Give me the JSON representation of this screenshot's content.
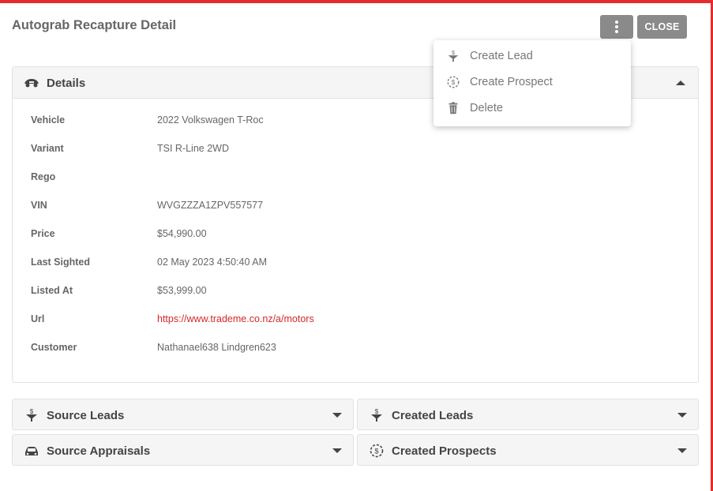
{
  "modal": {
    "title": "Autograb Recapture Detail",
    "close_label": "CLOSE"
  },
  "colors": {
    "accent": "#e52c2c",
    "link": "#d22a2a",
    "button_bg": "#8a8a8a"
  },
  "menu": {
    "items": [
      {
        "label": "Create Lead",
        "icon": "funnel-dollar-icon"
      },
      {
        "label": "Create Prospect",
        "icon": "dollar-target-icon"
      },
      {
        "label": "Delete",
        "icon": "trash-icon"
      }
    ]
  },
  "details": {
    "header": "Details",
    "icon": "car-eye-icon",
    "rows": [
      {
        "label": "Vehicle",
        "value": "2022 Volkswagen T-Roc"
      },
      {
        "label": "Variant",
        "value": "TSI R-Line 2WD"
      },
      {
        "label": "Rego",
        "value": ""
      },
      {
        "label": "VIN",
        "value": "WVGZZZA1ZPV557577"
      },
      {
        "label": "Price",
        "value": "$54,990.00"
      },
      {
        "label": "Last Sighted",
        "value": "02 May 2023 4:50:40 AM"
      },
      {
        "label": "Listed At",
        "value": "$53,999.00"
      },
      {
        "label": "Url",
        "value": "https://www.trademe.co.nz/a/motors"
      },
      {
        "label": "Customer",
        "value": "Nathanael638 Lindgren623"
      }
    ]
  },
  "sections": [
    {
      "label": "Source Leads",
      "icon": "funnel-dollar-icon"
    },
    {
      "label": "Created Leads",
      "icon": "funnel-dollar-icon"
    },
    {
      "label": "Source Appraisals",
      "icon": "car-dollar-icon"
    },
    {
      "label": "Created Prospects",
      "icon": "dollar-target-icon"
    }
  ]
}
